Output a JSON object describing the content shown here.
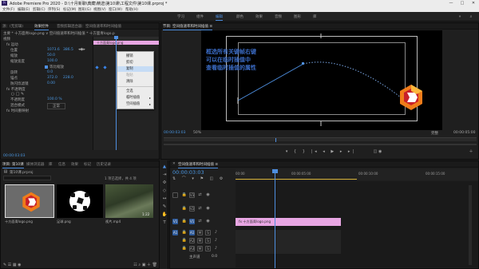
{
  "titlebar": {
    "logo": "Pr",
    "title": "Adobe Premiere Pro 2020 - D:\\十月新聊\\典藏\\精选\\第10课\\工程文件\\第10课.prproj *",
    "minimize": "—",
    "maximize": "□",
    "close": "✕"
  },
  "menu": [
    "文件(F)",
    "编辑(E)",
    "剪辑(C)",
    "序列(S)",
    "标记(M)",
    "图形(G)",
    "视图(V)",
    "窗口(W)",
    "帮助(H)"
  ],
  "workspaces": [
    {
      "label": "学习",
      "active": false
    },
    {
      "label": "组件",
      "active": false
    },
    {
      "label": "编辑",
      "active": true
    },
    {
      "label": "颜色",
      "active": false
    },
    {
      "label": "效果",
      "active": false
    },
    {
      "label": "音频",
      "active": false
    },
    {
      "label": "图形",
      "active": false
    },
    {
      "label": "库",
      "active": false
    }
  ],
  "effect_panel": {
    "tabs": [
      "源：(无剪辑)",
      "效果控件",
      "音频剪辑混合器：空间值速率和时间插值",
      "元数据"
    ],
    "source_path": "主要 * 十方面青logo.png ∨  空间值速率和时间插值 * 十方面青logo.png",
    "clip_label": "十方面青logo.png",
    "timecode": "00:00:03:03",
    "rows": [
      {
        "label": "视频",
        "indent": 0
      },
      {
        "label": "fx 运动",
        "indent": 1
      },
      {
        "label": "位置",
        "indent": 2,
        "v1": "1073.6",
        "v2": "386.5"
      },
      {
        "label": "缩放",
        "indent": 2,
        "v1": "50.0"
      },
      {
        "label": "缩放宽度",
        "indent": 3,
        "v1": "100.0"
      },
      {
        "label": "等比缩放",
        "indent": 3,
        "checked": true
      },
      {
        "label": "旋转",
        "indent": 2,
        "v1": "0.0"
      },
      {
        "label": "锚点",
        "indent": 2,
        "v1": "372.0",
        "v2": "228.0"
      },
      {
        "label": "防闪烁滤镜",
        "indent": 2,
        "v1": "0.00"
      },
      {
        "label": "fx 不透明度",
        "indent": 1
      },
      {
        "label": "不透明度",
        "indent": 2,
        "v1": "100.0 %"
      },
      {
        "label": "混合模式",
        "indent": 2,
        "v1": "正常"
      },
      {
        "label": "fx 时间重映射",
        "indent": 1
      }
    ],
    "bottom_time": "00:00:03:03"
  },
  "context_menu": {
    "items": [
      {
        "label": "撤销",
        "state": "normal"
      },
      {
        "label": "剪切",
        "state": "normal"
      },
      {
        "label": "复制",
        "state": "highlight"
      },
      {
        "label": "粘贴",
        "state": "disabled"
      },
      {
        "label": "清除",
        "state": "normal"
      },
      {
        "label": "sep",
        "state": "sep"
      },
      {
        "label": "全选",
        "state": "normal"
      },
      {
        "label": "临时插值",
        "state": "submenu"
      },
      {
        "label": "空间插值",
        "state": "submenu"
      }
    ]
  },
  "program_monitor": {
    "tab_title": "节目: 空间值速率和时间插值 ≡",
    "annotation": "框选所有关键帧右键\n可以在临时插值中\n查看临时插值的属性",
    "timecode_left": "00:00:03:03",
    "zoom": "50%",
    "fit": "完整",
    "timecode_right": "00:00:05:00"
  },
  "project_panel": {
    "tabs": [
      "项目: 第10课",
      "媒体浏览器",
      "库",
      "信息",
      "效果",
      "标记",
      "历史记录"
    ],
    "project_file": "第10课.prproj",
    "search_placeholder": "",
    "item_count": "1 项已选择，共 4 项",
    "items": [
      {
        "name": "十方面青logo.png",
        "duration": ""
      },
      {
        "name": "足球.png",
        "duration": ""
      },
      {
        "name": "视片.mp4",
        "duration": "1:22"
      }
    ]
  },
  "timeline": {
    "tab_title": "空间值速率和时间插值 ≡",
    "timecode": "00:00:03:03",
    "ruler": [
      "00:00",
      "00:00:05:00",
      "00:00:10:00",
      "00:00:15:00"
    ],
    "video_tracks": [
      "V3",
      "V2",
      "V1"
    ],
    "audio_tracks": [
      "A1",
      "A2",
      "A3"
    ],
    "master": "主声道",
    "master_value": "0.0",
    "clip_label": "fx 十方面青logo.png",
    "mute": "M",
    "solo": "S"
  },
  "colors": {
    "accent": "#4e8fe0",
    "clip_pink": "#e8a6e3",
    "annotation": "#3b6cc6",
    "logo_orange": "#f07c1a"
  }
}
